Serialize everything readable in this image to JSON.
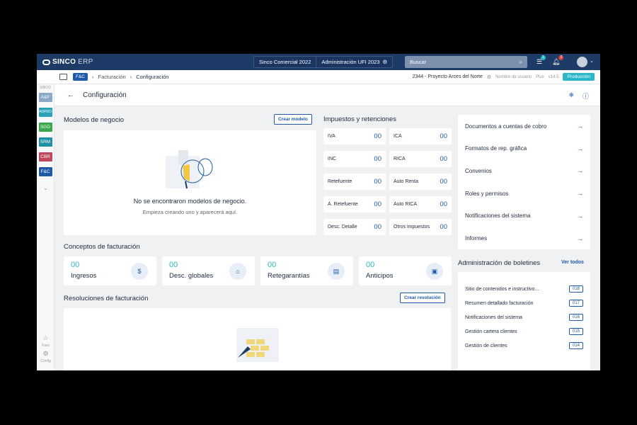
{
  "brand": {
    "name": "SINCO",
    "suffix": "ERP"
  },
  "topbar": {
    "company": "Sinco Comercial 2022",
    "admin": "Administración UFI 2023",
    "search_placeholder": "Buscar",
    "tasks_badge": "1",
    "notif_badge": "3"
  },
  "breadcrumb": {
    "chip": "F&C",
    "items": [
      "Facturación",
      "Configuración"
    ]
  },
  "project": {
    "name": "2344 - Proyecto Arces del Norte",
    "user": "Nombre de usuario",
    "plan": "Plus",
    "version": "v14.5",
    "env": "Producción"
  },
  "sidebar": {
    "label": "SINCO",
    "modules": [
      {
        "label": "A&F",
        "color": "#8aa9c9"
      },
      {
        "label": "ADPRO",
        "color": "#2aa3b8"
      },
      {
        "label": "SGD",
        "color": "#3aa64a"
      },
      {
        "label": "SRM",
        "color": "#1f8fa6"
      },
      {
        "label": "CBR",
        "color": "#c0475a"
      },
      {
        "label": "F&C",
        "color": "#1e5aa8"
      }
    ],
    "favs": "Favs",
    "config": "Config"
  },
  "page": {
    "title": "Configuración"
  },
  "modelos": {
    "title": "Modelos de negocio",
    "create": "Crear modelo",
    "empty_title": "No se encontraron modelos de negocio.",
    "empty_sub": "Empieza creando uno y aparecerá aquí."
  },
  "impuestos": {
    "title": "Impuestos y retenciones",
    "items": [
      {
        "name": "IVA",
        "value": "00"
      },
      {
        "name": "ICA",
        "value": "00"
      },
      {
        "name": "INC",
        "value": "00"
      },
      {
        "name": "RICA",
        "value": "00"
      },
      {
        "name": "Retefuente",
        "value": "00"
      },
      {
        "name": "Auto Renta",
        "value": "00"
      },
      {
        "name": "A. Retefuente",
        "value": "00"
      },
      {
        "name": "Auto RICA",
        "value": "00"
      },
      {
        "name": "Desc. Detalle",
        "value": "00"
      },
      {
        "name": "Otros impuestos",
        "value": "00"
      }
    ]
  },
  "conceptos": {
    "title": "Conceptos de facturación",
    "items": [
      {
        "value": "00",
        "label": "Ingresos",
        "icon": "dollar-icon"
      },
      {
        "value": "00",
        "label": "Desc. globales",
        "icon": "tag-icon"
      },
      {
        "value": "00",
        "label": "Retegarantías",
        "icon": "clipboard-icon"
      },
      {
        "value": "00",
        "label": "Anticipos",
        "icon": "archive-icon"
      }
    ]
  },
  "resoluciones": {
    "title": "Resoluciones de facturación",
    "create": "Crear resolución"
  },
  "links": [
    "Documentos a cuentas de cobro",
    "Formatos de rep. gráfica",
    "Convenios",
    "Roles y permisos",
    "Notificaciones del sistema",
    "Informes"
  ],
  "boletines": {
    "title": "Administración de boletines",
    "see_all": "Ver todos",
    "items": [
      {
        "label": "Sitio de contenidos e instructivo...",
        "num": "018"
      },
      {
        "label": "Resumen detallado facturación",
        "num": "017"
      },
      {
        "label": "Notificaciones del sistema",
        "num": "016"
      },
      {
        "label": "Gestión cartera clientes",
        "num": "015"
      },
      {
        "label": "Gestión de clientes",
        "num": "014"
      }
    ]
  }
}
